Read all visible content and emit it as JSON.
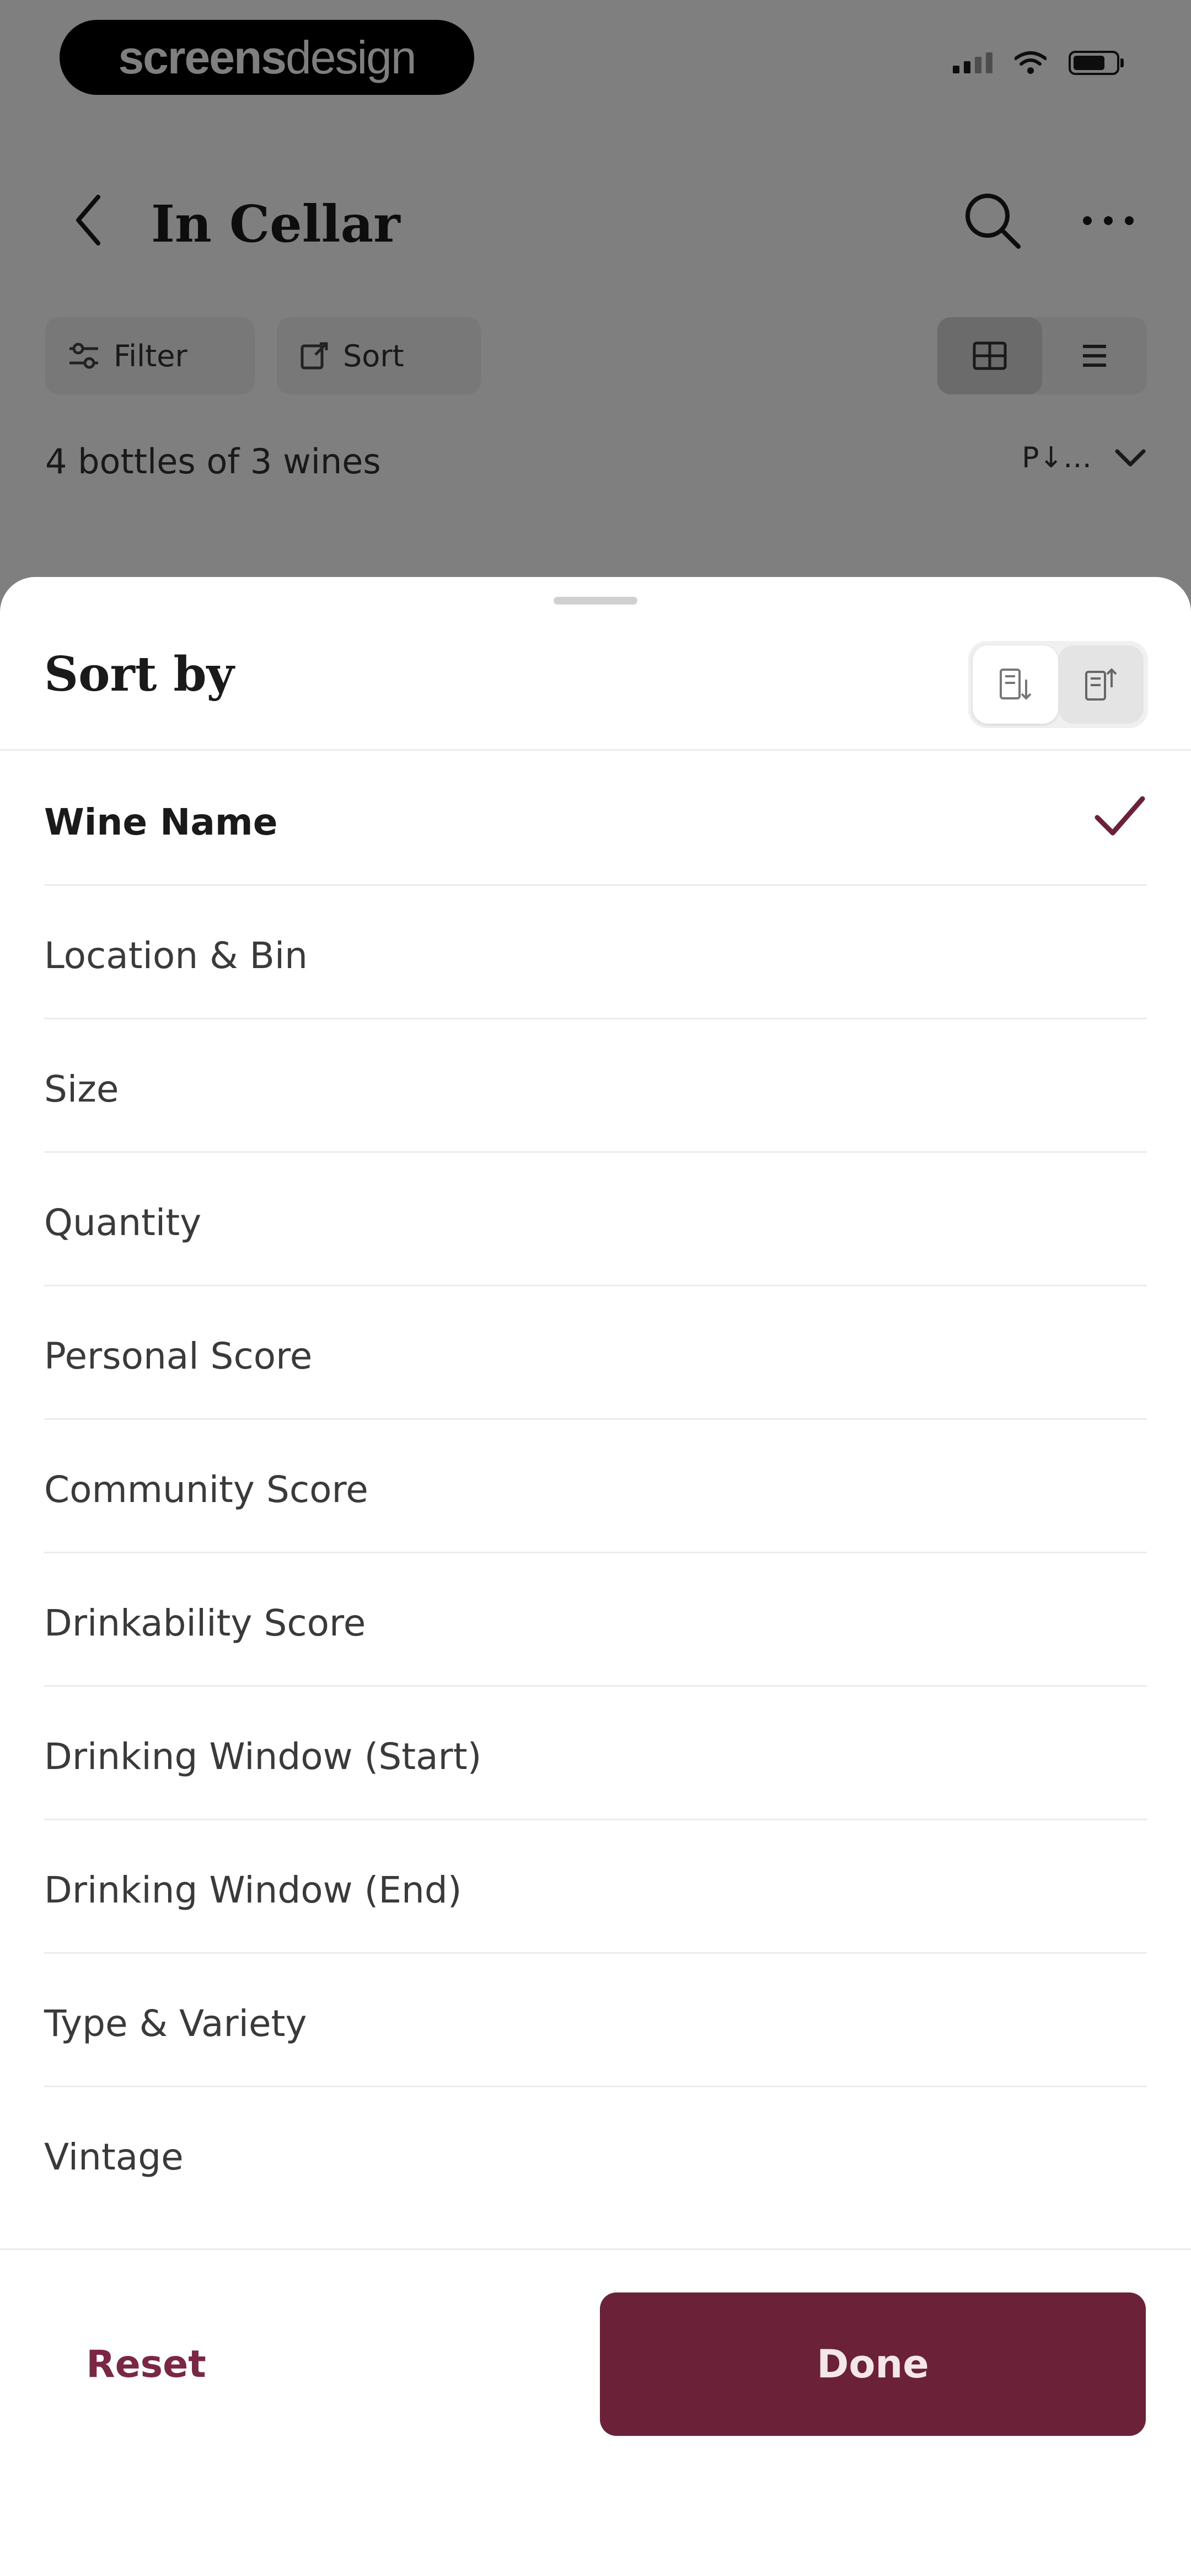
{
  "status_bar": {
    "brand_bold": "screens",
    "brand_light": "design"
  },
  "nav": {
    "title": "In Cellar",
    "icons": {
      "back": "chevron-left-icon",
      "search": "search-icon",
      "more": "more-horizontal-icon"
    }
  },
  "toolbar": {
    "filter_label": "Filter",
    "sort_label": "Sort",
    "view_modes": [
      "grid",
      "list"
    ],
    "active_view": "grid"
  },
  "summary": {
    "count_text": "4 bottles of 3 wines",
    "sort_indicator": "P↓…"
  },
  "sort_sheet": {
    "title": "Sort by",
    "order_options": [
      "ascending",
      "descending"
    ],
    "active_order": "ascending",
    "selected_index": 0,
    "options": [
      {
        "label": "Wine Name"
      },
      {
        "label": "Location & Bin"
      },
      {
        "label": "Size"
      },
      {
        "label": "Quantity"
      },
      {
        "label": "Personal Score"
      },
      {
        "label": "Community Score"
      },
      {
        "label": "Drinkability Score"
      },
      {
        "label": "Drinking Window (Start)"
      },
      {
        "label": "Drinking Window (End)"
      },
      {
        "label": "Type & Variety"
      },
      {
        "label": "Vintage"
      }
    ],
    "reset_label": "Reset",
    "done_label": "Done"
  },
  "colors": {
    "accent": "#6b2239",
    "accent_text": "#7a2745",
    "scrim": "rgba(0,0,0,0.5)"
  }
}
